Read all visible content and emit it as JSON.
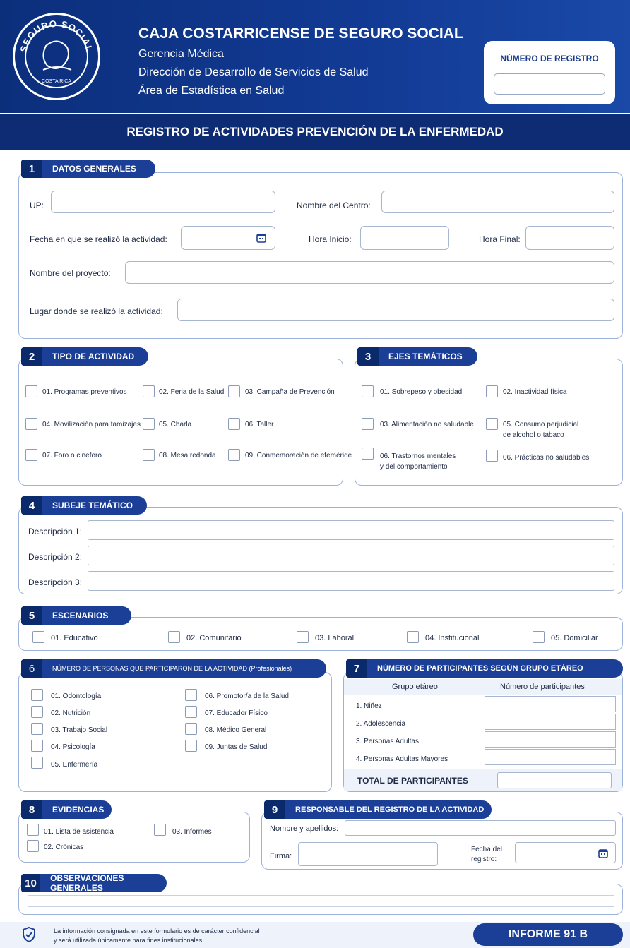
{
  "header": {
    "seal_text": "SEGURO SOCIAL",
    "seal_country": "COSTA RICA",
    "org": "CAJA COSTARRICENSE DE SEGURO SOCIAL",
    "line1": "Gerencia Médica",
    "line2": "Dirección de Desarrollo de Servicios de Salud",
    "line3": "Área de Estadística en Salud",
    "registro_label": "NÚMERO DE REGISTRO",
    "registro_value": ""
  },
  "title": "REGISTRO DE ACTIVIDADES PREVENCIÓN DE LA ENFERMEDAD",
  "s1": {
    "num": "1",
    "title": "DATOS GENERALES",
    "up": "UP:",
    "centro": "Nombre del Centro:",
    "fecha": "Fecha en que se realizó la actividad:",
    "hora_inicio": "Hora Inicio:",
    "hora_final": "Hora Final:",
    "proyecto": "Nombre del proyecto:",
    "lugar": "Lugar donde se realizó la actividad:"
  },
  "s2": {
    "num": "2",
    "title": "TIPO DE ACTIVIDAD",
    "items": [
      "01. Programas preventivos",
      "02. Feria de la Salud",
      "03. Campaña de Prevención",
      "04. Movilización para tamizajes",
      "05. Charla",
      "06. Taller",
      "07. Foro o cineforo",
      "08. Mesa redonda",
      "09. Conmemoración de efeméride"
    ]
  },
  "s3": {
    "num": "3",
    "title": "EJES TEMÁTICOS",
    "i1": "01. Sobrepeso y obesidad",
    "i2": "02. Inactividad física",
    "i3": "03. Alimentación no saludable",
    "i4a": "05. Consumo perjudicial",
    "i4b": "de alcohol o tabaco",
    "i5a": "06. Trastornos mentales",
    "i5b": "y del comportamiento",
    "i6": "06. Prácticas no saludables"
  },
  "s4": {
    "num": "4",
    "title": "SUBEJE TEMÁTICO",
    "d1": "Descripción 1:",
    "d2": "Descripción 2:",
    "d3": "Descripción 3:"
  },
  "s5": {
    "num": "5",
    "title": "ESCENARIOS",
    "items": [
      "01. Educativo",
      "02. Comunitario",
      "03. Laboral",
      "04. Institucional",
      "05. Domiciliar"
    ]
  },
  "s6": {
    "num": "6",
    "title": "NÚMERO DE PERSONAS QUE PARTICIPARON DE LA ACTIVIDAD (Profesionales)",
    "items": [
      "01. Odontología",
      "02. Nutrición",
      "03. Trabajo Social",
      "04. Psicología",
      "05. Enfermería",
      "06. Promotor/a de la Salud",
      "07. Educador Físico",
      "08. Médico General",
      "09. Juntas de Salud"
    ]
  },
  "s7": {
    "num": "7",
    "title": "NÚMERO DE PARTICIPANTES SEGÚN GRUPO ETÁREO",
    "col1": "Grupo etáreo",
    "col2": "Número de participantes",
    "rows": [
      "1.  Niñez",
      "2.  Adolescencia",
      "3.  Personas Adultas",
      "4.  Personas Adultas Mayores"
    ],
    "total": "TOTAL DE PARTICIPANTES"
  },
  "s8": {
    "num": "8",
    "title": "EVIDENCIAS",
    "i1": "01. Lista de asistencia",
    "i2": "02. Crónicas",
    "i3": "03. Informes"
  },
  "s9": {
    "num": "9",
    "title": "RESPONSABLE DEL REGISTRO DE LA ACTIVIDAD",
    "nombre": "Nombre y apellidos:",
    "firma": "Firma:",
    "fecha1": "Fecha del",
    "fecha2": "registro:"
  },
  "s10": {
    "num": "10",
    "title": "OBSERVACIONES GENERALES"
  },
  "footer": {
    "line1": "La información consignada en este formulario es de carácter confidencial",
    "line2": "y será utilizada únicamente para fines institucionales.",
    "badge": "INFORME 91 B"
  },
  "colors": {
    "primary": "#1b3f96",
    "dark": "#0e2c73",
    "border": "#9db2d8"
  }
}
